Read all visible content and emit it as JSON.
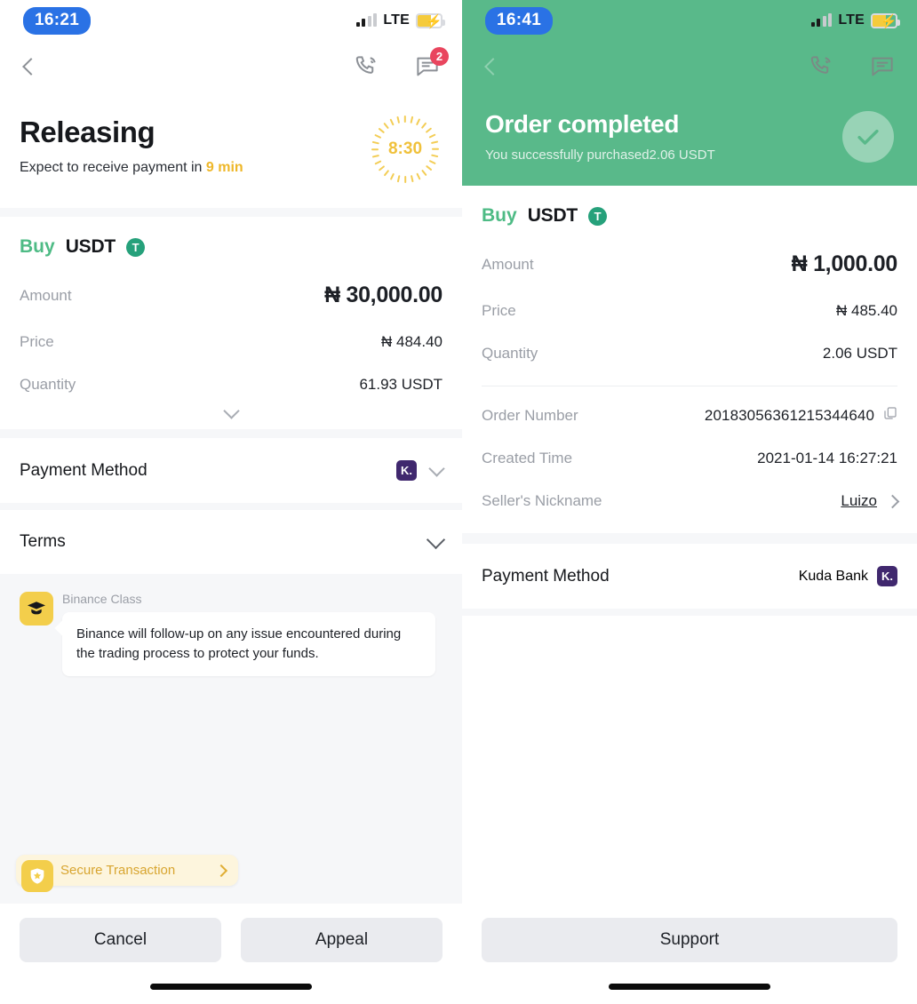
{
  "left": {
    "status": {
      "time": "16:21",
      "network": "LTE"
    },
    "nav": {
      "back_icon": "chevron-left-icon",
      "call_icon": "phone-call-icon",
      "chat_icon": "chat-bubble-icon",
      "chat_badge": "2"
    },
    "hero": {
      "title": "Releasing",
      "subtitle_prefix": "Expect to receive payment in ",
      "subtitle_highlight": "9 min",
      "timer": "8:30"
    },
    "order": {
      "side": "Buy",
      "coin": "USDT",
      "coin_symbol": "T",
      "rows": [
        {
          "label": "Amount",
          "value": "₦ 30,000.00"
        },
        {
          "label": "Price",
          "value": "₦ 484.40"
        },
        {
          "label": "Quantity",
          "value": "61.93 USDT"
        }
      ]
    },
    "payment_method": {
      "label": "Payment Method",
      "bank_badge": "K."
    },
    "terms": {
      "label": "Terms"
    },
    "chat": {
      "sender": "Binance Class",
      "message": "Binance will follow-up on any issue encountered during the trading process to protect your funds."
    },
    "secure": {
      "label": "Secure Transaction"
    },
    "buttons": {
      "cancel": "Cancel",
      "appeal": "Appeal"
    }
  },
  "right": {
    "status": {
      "time": "16:41",
      "network": "LTE"
    },
    "nav": {
      "back_icon": "chevron-left-icon",
      "call_icon": "phone-call-icon",
      "chat_icon": "chat-bubble-icon"
    },
    "hero": {
      "title": "Order completed",
      "subtitle": "You successfully purchased2.06 USDT",
      "check_icon": "check-circle-icon"
    },
    "order": {
      "side": "Buy",
      "coin": "USDT",
      "coin_symbol": "T",
      "rows": [
        {
          "label": "Amount",
          "value": "₦ 1,000.00"
        },
        {
          "label": "Price",
          "value": "₦ 485.40"
        },
        {
          "label": "Quantity",
          "value": "2.06 USDT"
        }
      ]
    },
    "details": {
      "order_number_label": "Order Number",
      "order_number": "20183056361215344640",
      "created_time_label": "Created Time",
      "created_time": "2021-01-14 16:27:21",
      "seller_label": "Seller's Nickname",
      "seller": "Luizo"
    },
    "payment_method": {
      "label": "Payment Method",
      "value": "Kuda Bank",
      "bank_badge": "K."
    },
    "buttons": {
      "support": "Support"
    }
  },
  "colors": {
    "green": "#59b98a",
    "buy_green": "#4ebb85",
    "yellow": "#f3ce4b",
    "badge_red": "#e9455e",
    "time_blue": "#2a72e5",
    "kuda_purple": "#40286e",
    "tether_green": "#26a17b"
  }
}
